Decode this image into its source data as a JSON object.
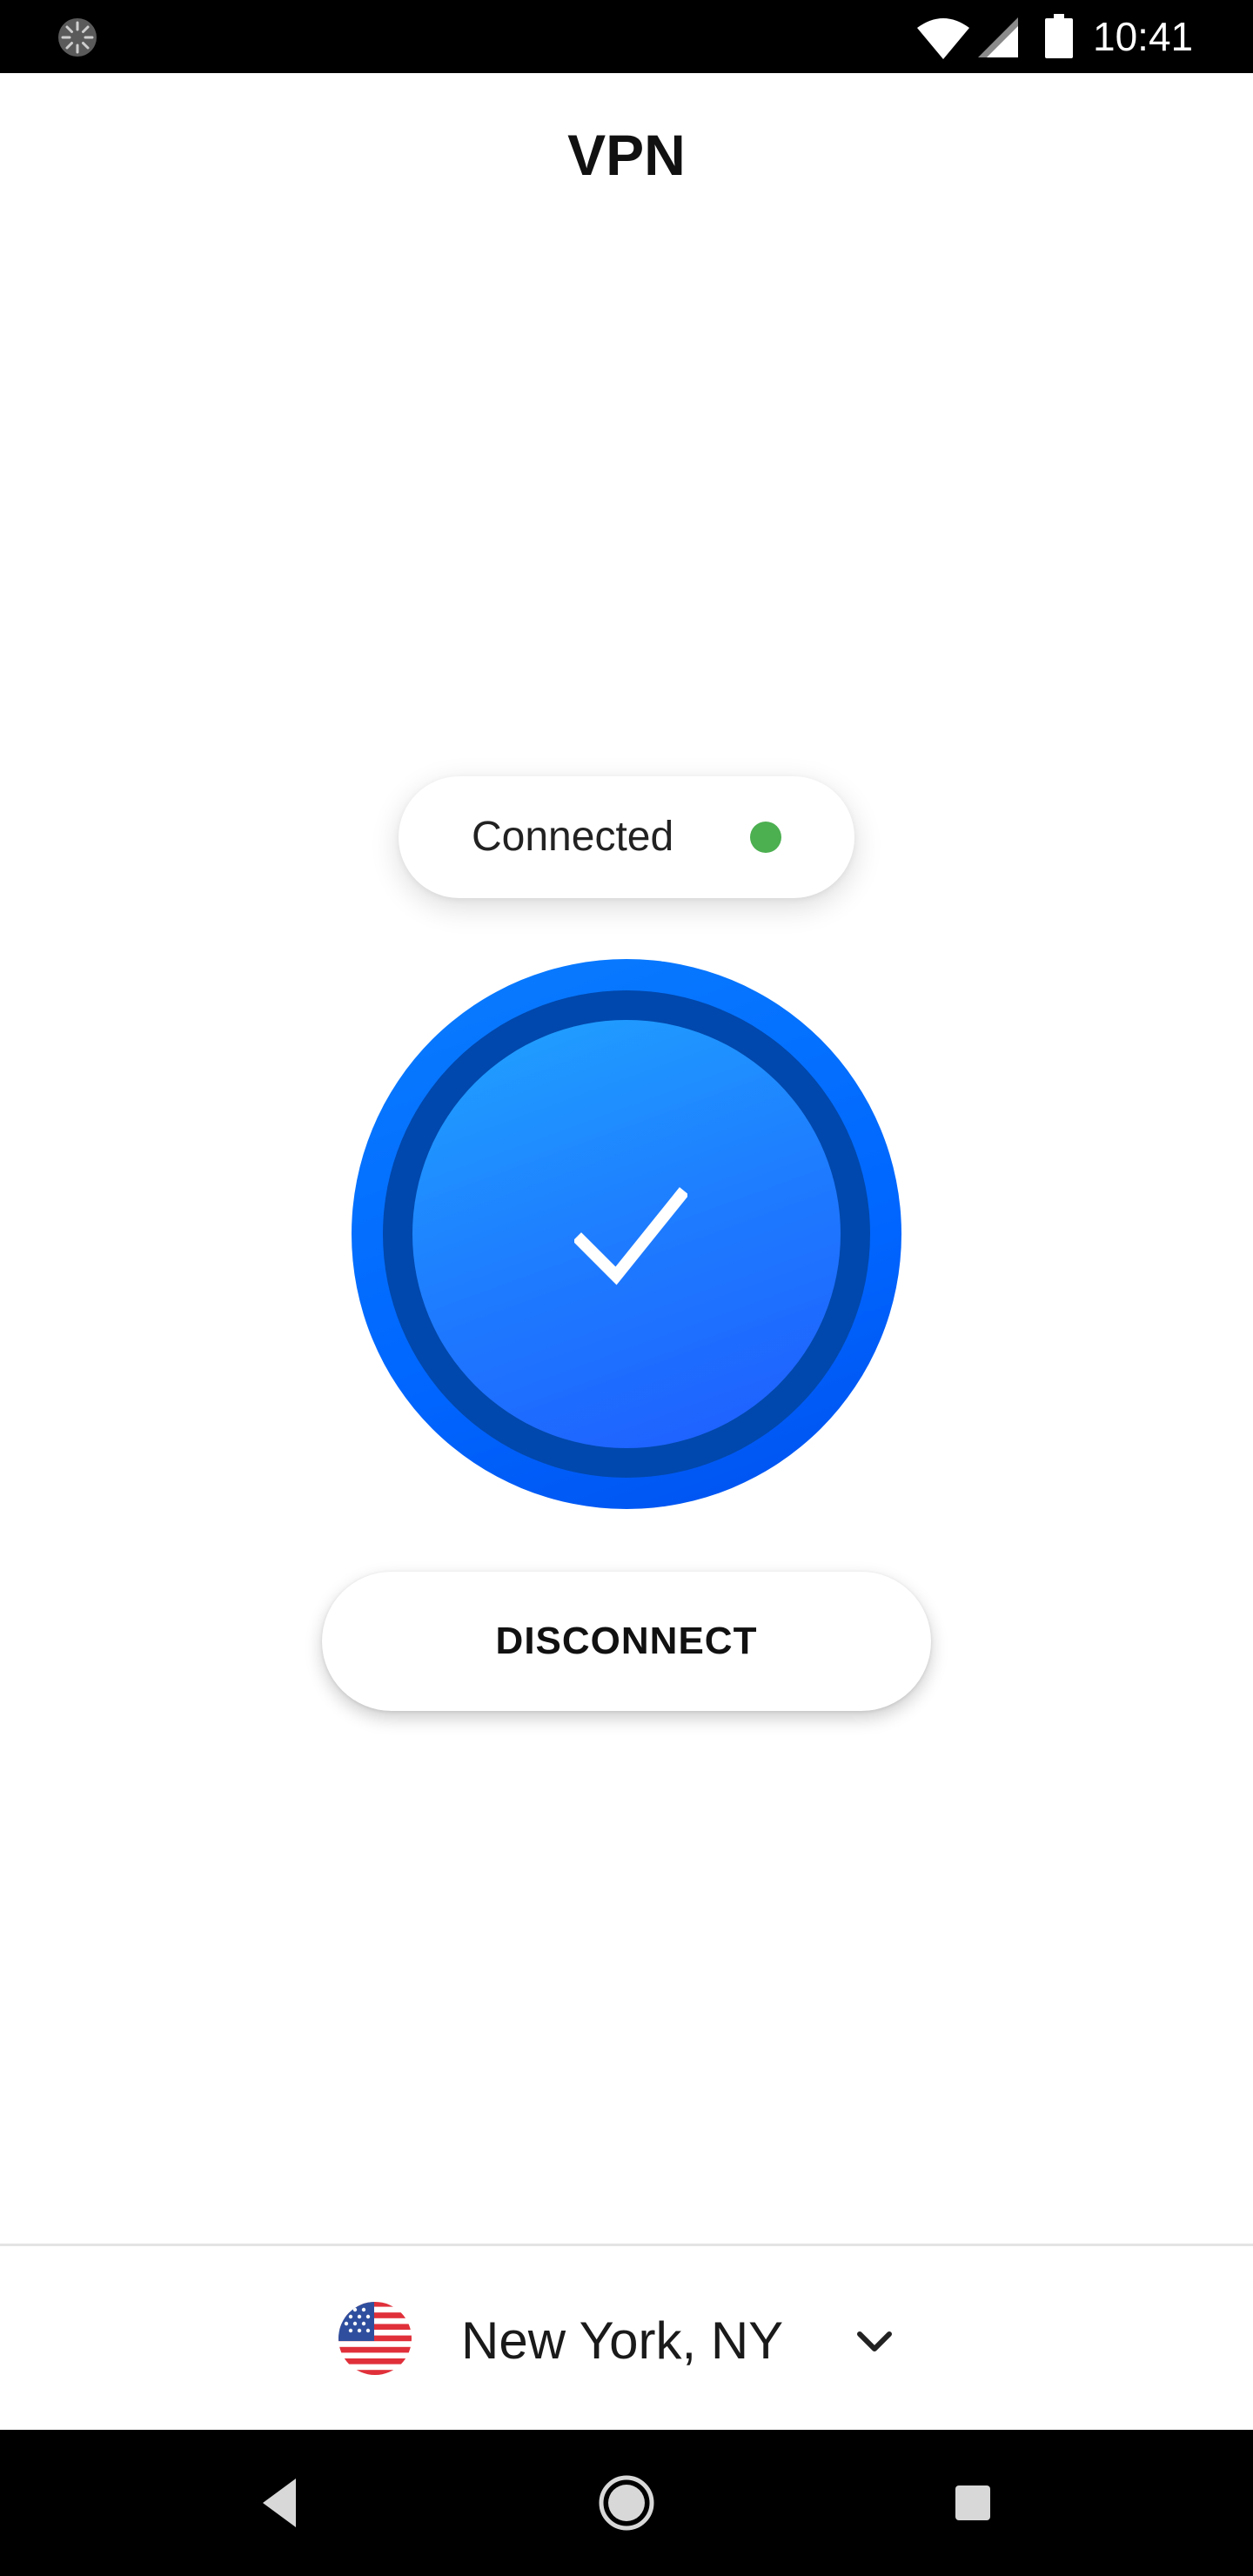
{
  "status_bar": {
    "time": "10:41",
    "icons": [
      "loading-spinner-icon",
      "wifi-icon",
      "cell-signal-icon",
      "battery-icon"
    ]
  },
  "header": {
    "title": "VPN"
  },
  "connection": {
    "status_label": "Connected",
    "status_color": "#4caf50",
    "state_icon": "checkmark-icon",
    "accent_color": "#0066ff"
  },
  "actions": {
    "disconnect_label": "DISCONNECT"
  },
  "location": {
    "label": "New York, NY",
    "flag_icon": "us-flag-icon",
    "expand_icon": "chevron-down-icon"
  },
  "nav_bar": {
    "icons": [
      "back-icon",
      "home-icon",
      "recents-icon"
    ]
  }
}
